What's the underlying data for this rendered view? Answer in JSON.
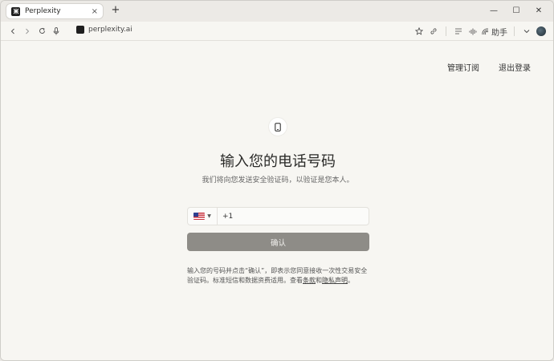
{
  "browser": {
    "tab": {
      "title": "Perplexity",
      "close_icon": "×"
    },
    "new_tab_icon": "+",
    "window_controls": {
      "minimize": "—",
      "maximize": "☐",
      "close": "✕"
    },
    "url": "perplexity.ai",
    "assistant_label": "助手"
  },
  "page": {
    "top_links": {
      "manage_subscription": "管理订阅",
      "logout": "退出登录"
    },
    "heading": "输入您的电话号码",
    "subheading": "我们将向您发送安全验证码，以验证是您本人。",
    "phone": {
      "dial_code": "+1",
      "placeholder": ""
    },
    "confirm_label": "确认",
    "terms": {
      "part1": "输入您的号码并点击“确认”，即表示您同意接收一次性交易安全验证码。标准短信和数据资费适用。查看",
      "terms_link": "条款",
      "and": "和",
      "privacy_link": "隐私声明",
      "end": "。"
    }
  }
}
